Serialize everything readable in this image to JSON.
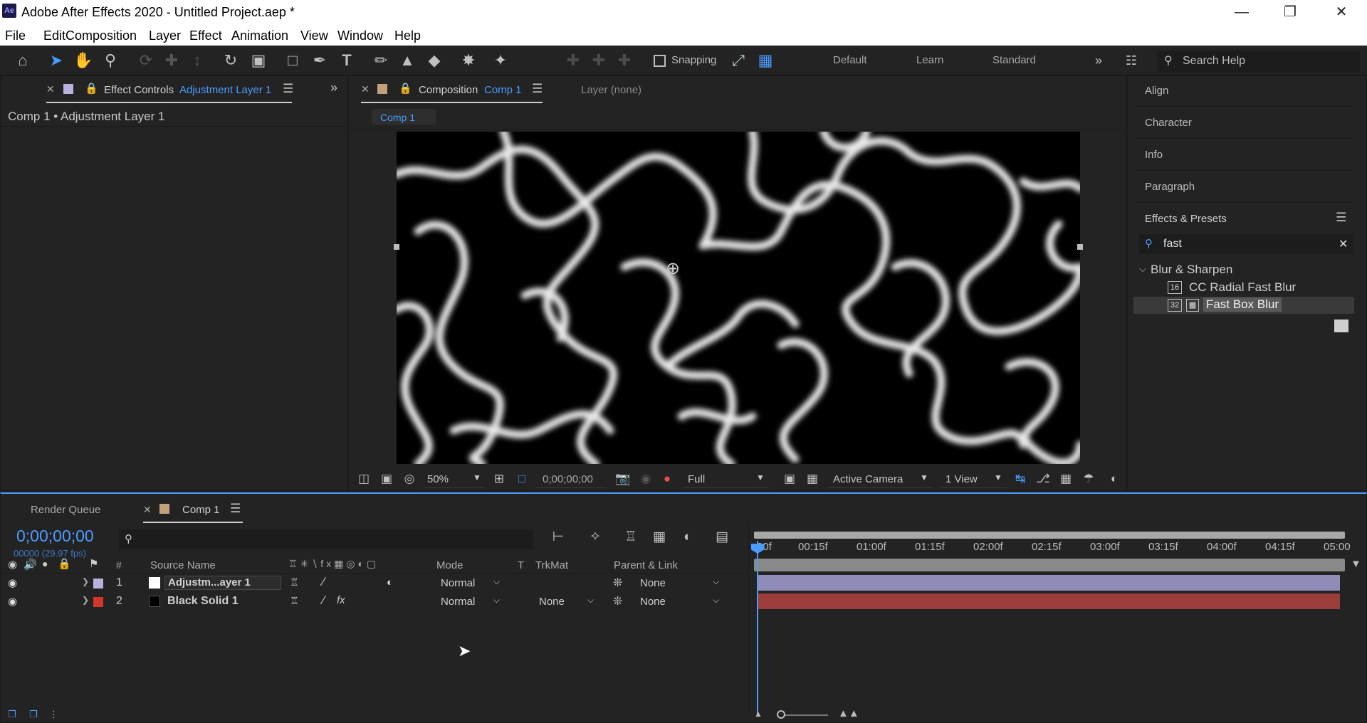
{
  "window": {
    "title": "Adobe After Effects 2020 - Untitled Project.aep *",
    "app_icon": "Ae",
    "controls": [
      "minimize-icon",
      "restore-icon",
      "close-icon"
    ]
  },
  "menu": [
    "File",
    "Edit",
    "Composition",
    "Layer",
    "Effect",
    "Animation",
    "View",
    "Window",
    "Help"
  ],
  "toolbar": {
    "snapping_label": "Snapping",
    "workspaces": [
      "Default",
      "Learn",
      "Standard"
    ],
    "search_help_placeholder": "Search Help"
  },
  "effect_controls": {
    "tab_label": "Effect Controls",
    "tab_layer": "Adjustment Layer 1",
    "breadcrumb": "Comp 1 • Adjustment Layer 1"
  },
  "composition_panel": {
    "tab_label": "Composition",
    "tab_comp": "Comp 1",
    "layer_tab": "Layer (none)",
    "subtab": "Comp 1",
    "zoom": "50%",
    "timecode": "0;00;00;00",
    "resolution": "Full",
    "camera": "Active Camera",
    "views": "1 View"
  },
  "right_panel": {
    "items": [
      "Align",
      "Character",
      "Info",
      "Paragraph",
      "Effects & Presets"
    ],
    "search_value": "fast",
    "category": "Blur & Sharpen",
    "effects": [
      {
        "bits": "16",
        "label": "CC Radial Fast Blur"
      },
      {
        "bits": "32",
        "label": "Fast Box Blur"
      }
    ]
  },
  "timeline": {
    "render_queue_tab": "Render Queue",
    "comp_tab": "Comp 1",
    "timecode": "0;00;00;00",
    "frame_info": "00000 (29.97 fps)",
    "columns": {
      "num": "#",
      "source": "Source Name",
      "mode": "Mode",
      "t": "T",
      "trkmat": "TrkMat",
      "parent": "Parent & Link"
    },
    "ruler": [
      "00f",
      "00:15f",
      "01:00f",
      "01:15f",
      "02:00f",
      "02:15f",
      "03:00f",
      "03:15f",
      "04:00f",
      "04:15f",
      "05:00"
    ],
    "layers": [
      {
        "num": "1",
        "name": "Adjustm...ayer 1",
        "mode": "Normal",
        "trkmat": "",
        "parent": "None",
        "label_color": "#b7b2e0",
        "bar_color": "#8f8cb8"
      },
      {
        "num": "2",
        "name": "Black Solid 1",
        "mode": "Normal",
        "trkmat": "None",
        "parent": "None",
        "label_color": "#d2372b",
        "bar_color": "#9a3d3b"
      }
    ]
  }
}
